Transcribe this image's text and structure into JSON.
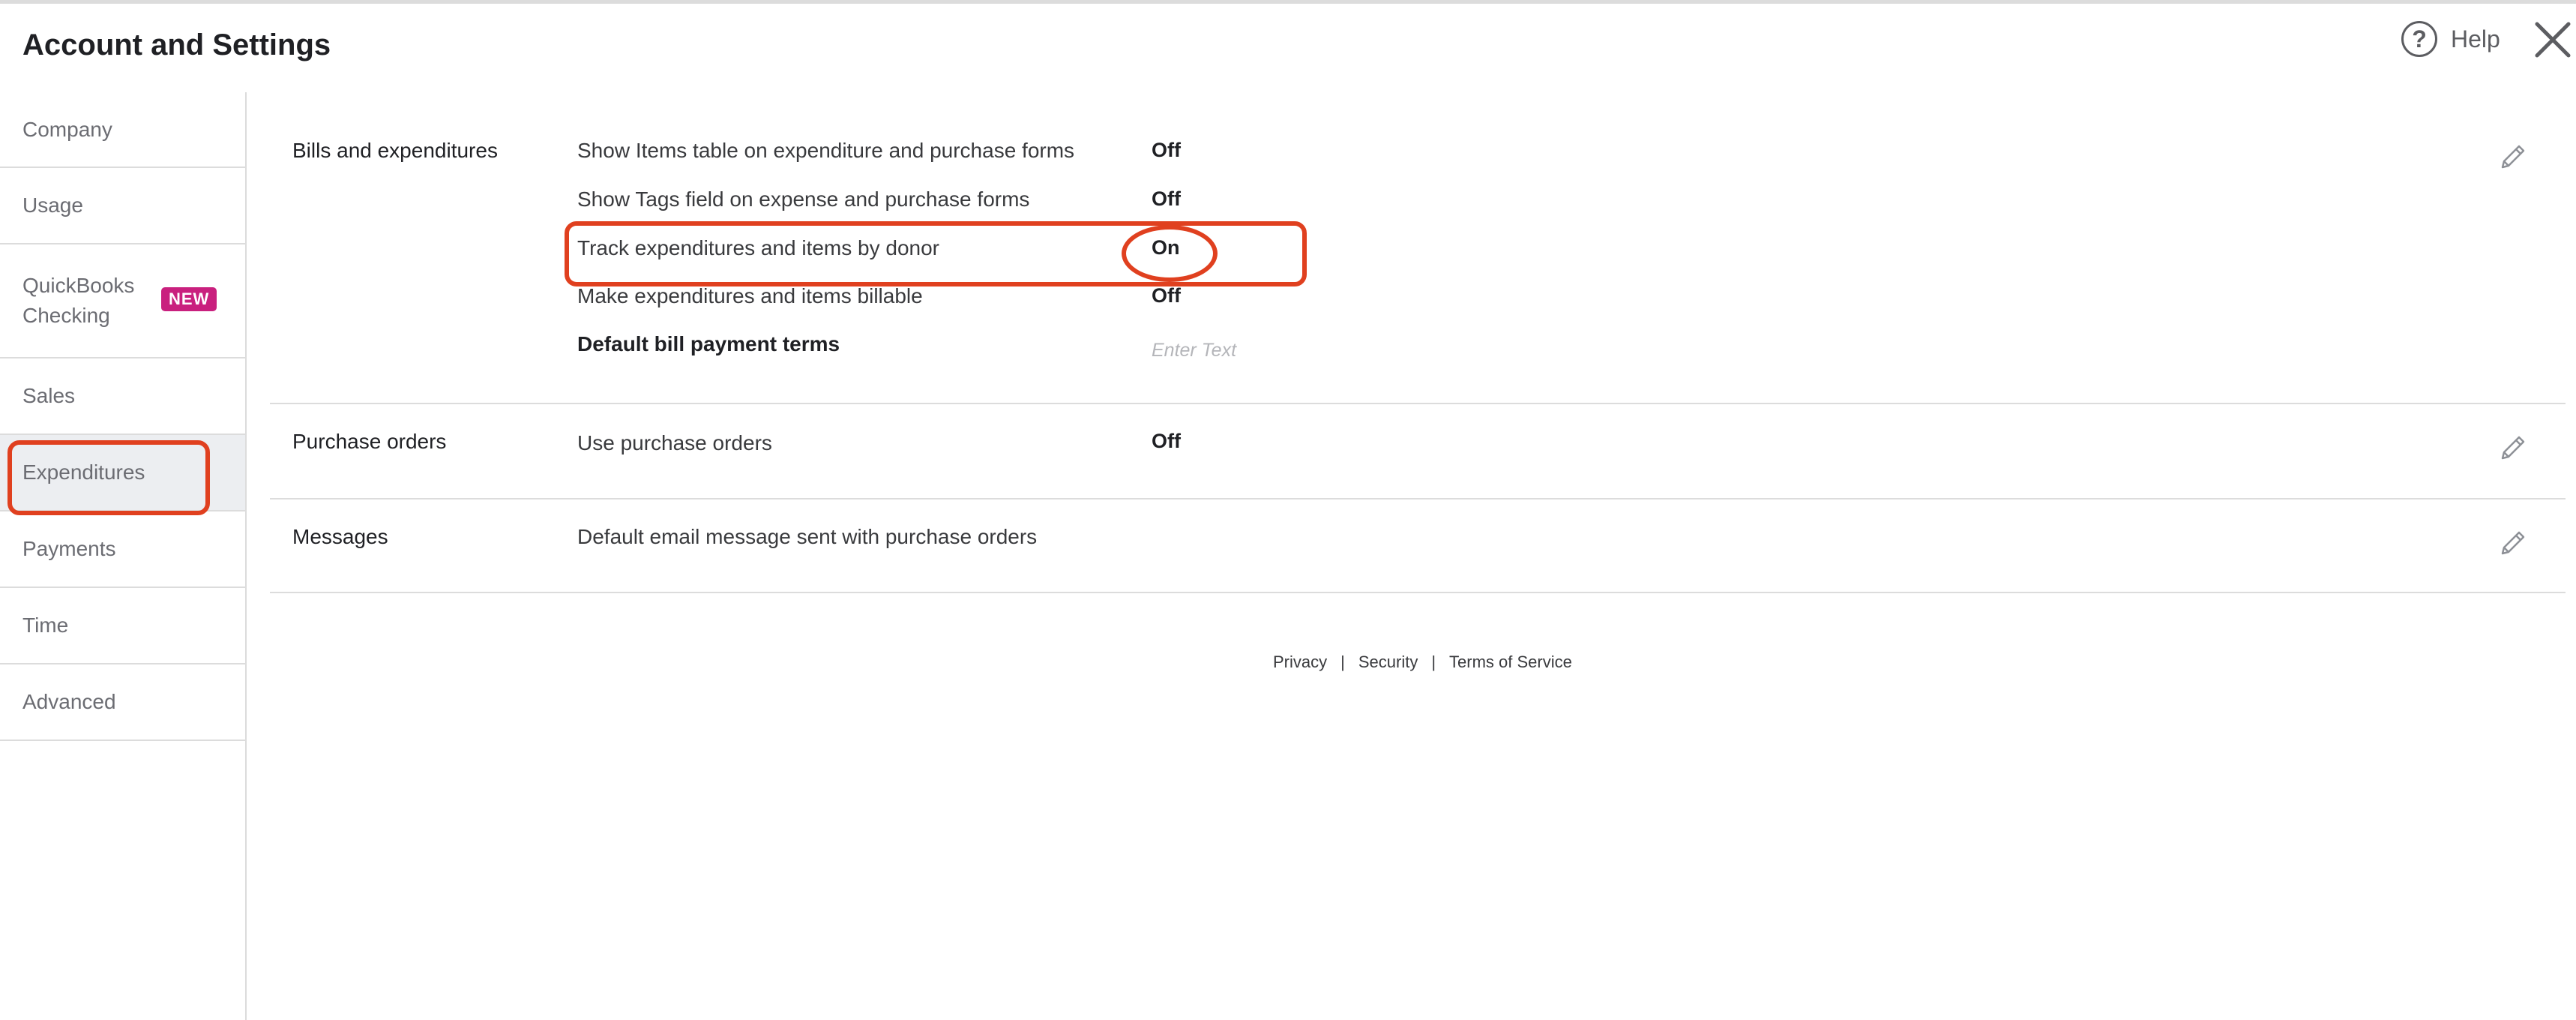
{
  "page": {
    "title": "Account and Settings"
  },
  "header": {
    "help_label": "Help",
    "help_icon": "?"
  },
  "sidebar": {
    "items": [
      {
        "label": "Company"
      },
      {
        "label": "Usage"
      },
      {
        "label": "QuickBooks Checking",
        "badge": "NEW"
      },
      {
        "label": "Sales"
      },
      {
        "label": "Expenditures",
        "active": true
      },
      {
        "label": "Payments"
      },
      {
        "label": "Time"
      },
      {
        "label": "Advanced"
      }
    ]
  },
  "sections": {
    "bills": {
      "name": "Bills and expenditures",
      "rows": [
        {
          "label": "Show Items table on expenditure and purchase forms",
          "value": "Off"
        },
        {
          "label": "Show Tags field on expense and purchase forms",
          "value": "Off"
        },
        {
          "label": "Track expenditures and items by donor",
          "value": "On"
        },
        {
          "label": "Make expenditures and items billable",
          "value": "Off"
        },
        {
          "label": "Default bill payment terms",
          "placeholder": "Enter Text"
        }
      ]
    },
    "purchase_orders": {
      "name": "Purchase orders",
      "rows": [
        {
          "label": "Use purchase orders",
          "value": "Off"
        }
      ]
    },
    "messages": {
      "name": "Messages",
      "rows": [
        {
          "label": "Default email message sent with purchase orders"
        }
      ]
    }
  },
  "footer": {
    "privacy": "Privacy",
    "security": "Security",
    "terms": "Terms of Service",
    "separator": "|"
  },
  "colors": {
    "annotation": "#e0401f",
    "badge": "#c9207e",
    "divider": "#dcdcdc",
    "active_bg": "#eceef1"
  }
}
